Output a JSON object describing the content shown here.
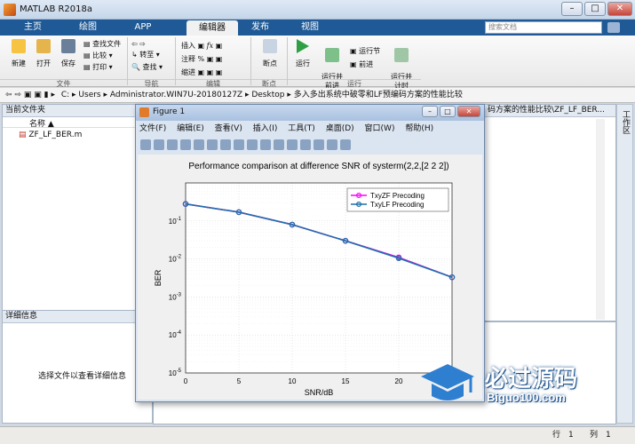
{
  "app": {
    "title": "MATLAB R2018a"
  },
  "tabs": [
    "主页",
    "绘图",
    "APP",
    "编辑器",
    "发布",
    "视图"
  ],
  "search": {
    "placeholder": "搜索文档"
  },
  "ribbon": {
    "file_buttons": [
      "新建",
      "打开",
      "保存"
    ],
    "file_small": [
      "查找文件",
      "比较",
      "打印"
    ],
    "nav_small": [
      "转至",
      "查找"
    ],
    "edit_small": [
      "插入",
      "注释",
      "缩进"
    ],
    "breakpoint": "断点",
    "run": [
      "运行",
      "运行并\n前进",
      "运行节",
      "前进",
      "运行并\n计时"
    ],
    "sections": [
      "文件",
      "导航",
      "编辑",
      "断点",
      "运行"
    ]
  },
  "address": {
    "parts": [
      "C:",
      "Users",
      "Administrator.WIN7U-20180127Z",
      "Desktop",
      "多入多出系统中破零和LF预编码方案的性能比较"
    ]
  },
  "left_panel": {
    "header": "当前文件夹",
    "col_name": "名称",
    "file": "ZF_LF_BER.m"
  },
  "detail_panel": {
    "header": "详细信息",
    "hint": "选择文件以查看详细信息"
  },
  "right_header": "码方案的性能比较\\ZF_LF_BER...",
  "right_side_label": "工作区",
  "figure": {
    "title": "Figure 1",
    "menu": [
      "文件(F)",
      "编辑(E)",
      "查看(V)",
      "插入(I)",
      "工具(T)",
      "桌面(D)",
      "窗口(W)",
      "帮助(H)"
    ]
  },
  "chart_data": {
    "type": "line",
    "title": "Performance comparison at difference SNR of systerm(2,2,[2 2 2])",
    "xlabel": "SNR/dB",
    "ylabel": "BER",
    "xlim": [
      0,
      25
    ],
    "ylim": [
      1e-05,
      1
    ],
    "yscale": "log",
    "xticks": [
      0,
      5,
      10,
      15,
      20,
      25
    ],
    "yticks": [
      "10^-5",
      "10^-4",
      "10^-3",
      "10^-2",
      "10^-1"
    ],
    "grid": true,
    "legend_position": "top-right",
    "x": [
      0,
      5,
      10,
      15,
      20,
      25
    ],
    "series": [
      {
        "name": "TxyZF Precoding",
        "color": "#ff00ff",
        "values": [
          0.28,
          0.17,
          0.08,
          0.03,
          0.011,
          0.0033
        ]
      },
      {
        "name": "TxyLF Precoding",
        "color": "#1f6fa8",
        "values": [
          0.28,
          0.17,
          0.08,
          0.03,
          0.0105,
          0.0033
        ]
      }
    ]
  },
  "brand": {
    "name": "必过源码",
    "url": "Biguo100.com"
  },
  "status": {
    "line_label": "行",
    "line": "1",
    "col_label": "列",
    "col": "1"
  },
  "colors": {
    "tab_bar": "#1f5a96",
    "accent_zf": "#ff00ff",
    "accent_lf": "#1f6fa8"
  }
}
